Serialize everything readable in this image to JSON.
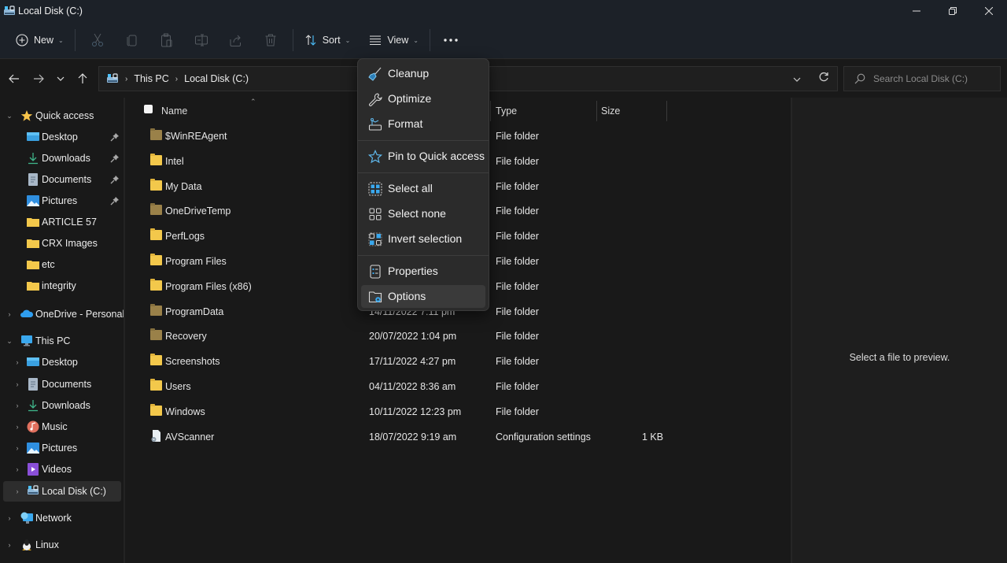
{
  "window": {
    "title": "Local Disk (C:)",
    "controls": {
      "minimize": "minimize",
      "maximize": "restore",
      "close": "close"
    }
  },
  "toolbar": {
    "new_label": "New",
    "sort_label": "Sort",
    "view_label": "View",
    "icons": [
      "cut-icon",
      "copy-icon",
      "paste-icon",
      "rename-icon",
      "share-icon",
      "delete-icon"
    ],
    "more_label": "…"
  },
  "address": {
    "crumbs": [
      "This PC",
      "Local Disk (C:)"
    ],
    "separator": "›"
  },
  "search": {
    "placeholder": "Search Local Disk (C:)"
  },
  "sidebar": {
    "quick_access": {
      "label": "Quick access",
      "items": [
        {
          "label": "Desktop",
          "icon": "desktop-icon",
          "pinned": true
        },
        {
          "label": "Downloads",
          "icon": "downloads-icon",
          "pinned": true
        },
        {
          "label": "Documents",
          "icon": "documents-icon",
          "pinned": true
        },
        {
          "label": "Pictures",
          "icon": "pictures-icon",
          "pinned": true
        },
        {
          "label": "ARTICLE 57",
          "icon": "folder-icon",
          "pinned": false
        },
        {
          "label": "CRX Images",
          "icon": "folder-icon",
          "pinned": false
        },
        {
          "label": "etc",
          "icon": "folder-icon",
          "pinned": false
        },
        {
          "label": "integrity",
          "icon": "folder-icon",
          "pinned": false
        }
      ]
    },
    "onedrive": {
      "label": "OneDrive - Personal"
    },
    "this_pc": {
      "label": "This PC",
      "items": [
        {
          "label": "Desktop",
          "icon": "desktop-icon"
        },
        {
          "label": "Documents",
          "icon": "documents-icon"
        },
        {
          "label": "Downloads",
          "icon": "downloads-icon"
        },
        {
          "label": "Music",
          "icon": "music-icon"
        },
        {
          "label": "Pictures",
          "icon": "pictures-icon"
        },
        {
          "label": "Videos",
          "icon": "videos-icon"
        },
        {
          "label": "Local Disk (C:)",
          "icon": "drive-icon",
          "selected": true
        }
      ]
    },
    "network": {
      "label": "Network"
    },
    "linux": {
      "label": "Linux"
    }
  },
  "filelist": {
    "columns": {
      "name": "Name",
      "type": "Type",
      "size": "Size"
    },
    "rows": [
      {
        "name": "$WinREAgent",
        "date": "",
        "type": "File folder",
        "size": "",
        "icon": "folder-hidden"
      },
      {
        "name": "Intel",
        "date": "",
        "type": "File folder",
        "size": "",
        "icon": "folder"
      },
      {
        "name": "My Data",
        "date": "",
        "type": "File folder",
        "size": "",
        "icon": "folder"
      },
      {
        "name": "OneDriveTemp",
        "date": "",
        "type": "File folder",
        "size": "",
        "icon": "folder-hidden"
      },
      {
        "name": "PerfLogs",
        "date": "",
        "type": "File folder",
        "size": "",
        "icon": "folder"
      },
      {
        "name": "Program Files",
        "date": "",
        "type": "File folder",
        "size": "",
        "icon": "folder"
      },
      {
        "name": "Program Files (x86)",
        "date": "",
        "type": "File folder",
        "size": "",
        "icon": "folder"
      },
      {
        "name": "ProgramData",
        "date": "14/11/2022 7:11 pm",
        "type": "File folder",
        "size": "",
        "icon": "folder-hidden"
      },
      {
        "name": "Recovery",
        "date": "20/07/2022 1:04 pm",
        "type": "File folder",
        "size": "",
        "icon": "folder-hidden"
      },
      {
        "name": "Screenshots",
        "date": "17/11/2022 4:27 pm",
        "type": "File folder",
        "size": "",
        "icon": "folder"
      },
      {
        "name": "Users",
        "date": "04/11/2022 8:36 am",
        "type": "File folder",
        "size": "",
        "icon": "folder"
      },
      {
        "name": "Windows",
        "date": "10/11/2022 12:23 pm",
        "type": "File folder",
        "size": "",
        "icon": "folder"
      },
      {
        "name": "AVScanner",
        "date": "18/07/2022 9:19 am",
        "type": "Configuration settings",
        "size": "1 KB",
        "icon": "config-file"
      }
    ]
  },
  "preview": {
    "message": "Select a file to preview."
  },
  "context_menu": {
    "groups": [
      [
        {
          "label": "Cleanup",
          "icon": "cleanup-icon"
        },
        {
          "label": "Optimize",
          "icon": "optimize-icon"
        },
        {
          "label": "Format",
          "icon": "format-icon"
        }
      ],
      [
        {
          "label": "Pin to Quick access",
          "icon": "pin-star-icon"
        }
      ],
      [
        {
          "label": "Select all",
          "icon": "select-all-icon"
        },
        {
          "label": "Select none",
          "icon": "select-none-icon"
        },
        {
          "label": "Invert selection",
          "icon": "invert-selection-icon"
        }
      ],
      [
        {
          "label": "Properties",
          "icon": "properties-icon"
        },
        {
          "label": "Options",
          "icon": "options-icon",
          "hovered": true
        }
      ]
    ]
  },
  "colors": {
    "accent": "#4cc2ff",
    "folder": "#f3c84b",
    "folder_hidden": "#9a8149",
    "chrome": "#1c2128",
    "background": "#191919",
    "menu": "#2b2b2b"
  }
}
